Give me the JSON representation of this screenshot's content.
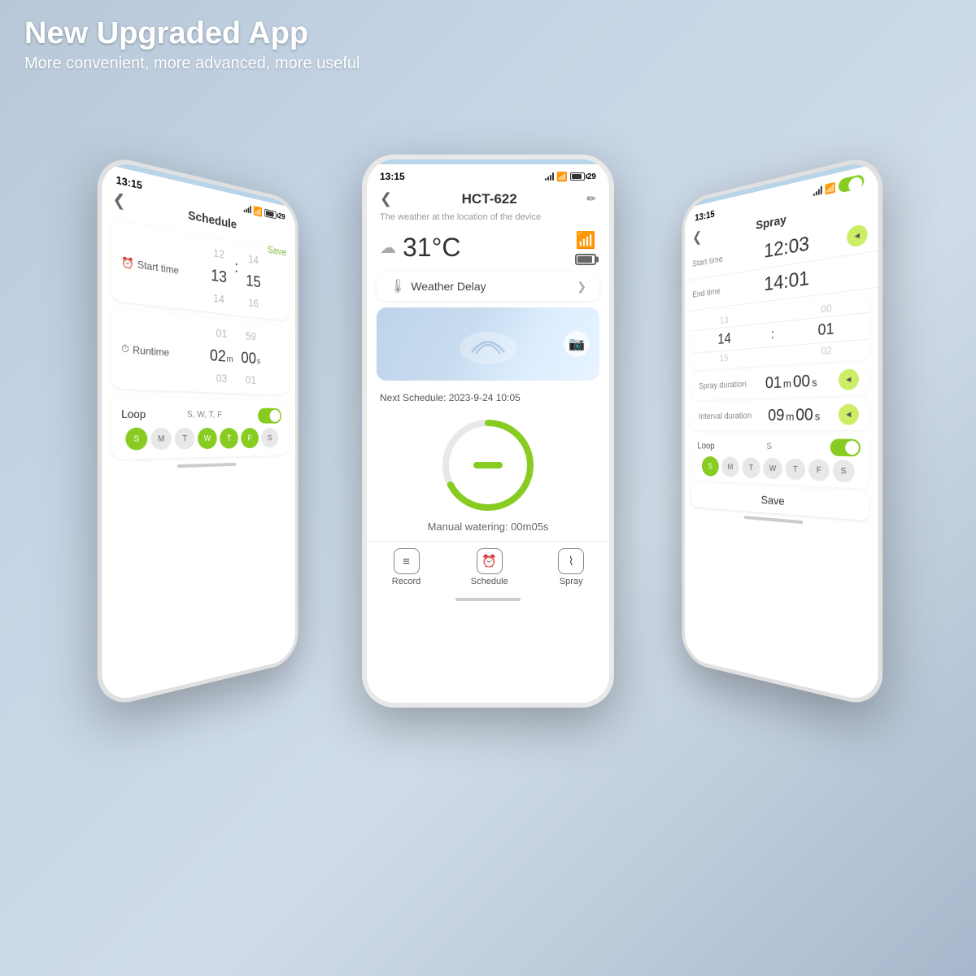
{
  "header": {
    "title": "New Upgraded App",
    "subtitle": "More convenient, more advanced, more useful"
  },
  "status_bar": {
    "time": "13:15",
    "battery_num": "29"
  },
  "center_phone": {
    "nav_title": "HCT-622",
    "subtitle": "The weather at the location of the device",
    "temperature": "31°C",
    "weather_delay_label": "Weather Delay",
    "next_schedule": "Next Schedule:  2023-9-24 10:05",
    "manual_watering": "Manual watering: 00m05s",
    "bottom_nav": {
      "record": "Record",
      "schedule": "Schedule",
      "spray": "Spray"
    }
  },
  "left_phone": {
    "title": "Schedule",
    "save": "Save",
    "start_time": {
      "label": "Start time",
      "hours": [
        "12",
        "13",
        "14"
      ],
      "minutes": [
        "14",
        "15",
        "16"
      ]
    },
    "runtime": {
      "label": "Runtime",
      "values_m": [
        "01",
        "02",
        "03"
      ],
      "unit_m": "m",
      "values_s": [
        "59",
        "00",
        "01"
      ],
      "unit_s": "s"
    },
    "loop": {
      "label": "Loop",
      "days_text": "S, W, T, F",
      "days": [
        "S",
        "M",
        "T",
        "W",
        "T",
        "F",
        "S"
      ],
      "active_days": [
        0,
        3,
        4,
        5
      ]
    }
  },
  "right_phone": {
    "title": "Spray",
    "time": "13:15",
    "start_time": {
      "label": "Start time",
      "value": "12:03"
    },
    "end_time": {
      "label": "End time",
      "value": "14:01"
    },
    "scroll_cols": {
      "hour_values": [
        "13",
        "14",
        "15"
      ],
      "minute_values": [
        "00",
        "01",
        "02"
      ]
    },
    "spray_duration": {
      "label": "Spray duration",
      "value_m": "01",
      "unit_m": "m",
      "value_s": "00",
      "unit_s": "s"
    },
    "interval_duration": {
      "label": "Interval duration",
      "value_m": "09",
      "unit_m": "m",
      "value_s": "00",
      "unit_s": "s"
    },
    "loop": {
      "label": "Loop",
      "days_text": "S",
      "days": [
        "S",
        "M",
        "T",
        "W",
        "T",
        "F",
        "S"
      ],
      "active_days": [
        0
      ]
    },
    "save": "Save"
  }
}
